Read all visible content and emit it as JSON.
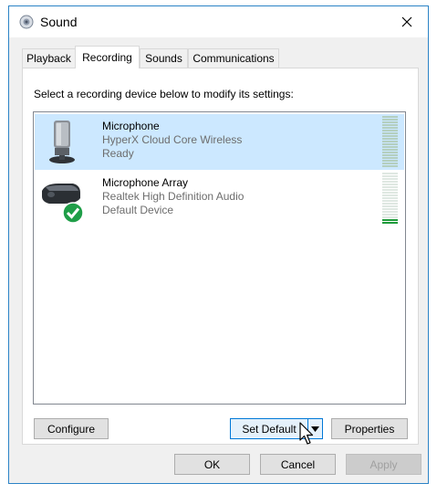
{
  "window": {
    "title": "Sound",
    "title_icon": "speaker-icon",
    "close_icon": "close-icon"
  },
  "tabs": [
    {
      "label": "Playback",
      "active": false
    },
    {
      "label": "Recording",
      "active": true
    },
    {
      "label": "Sounds",
      "active": false
    },
    {
      "label": "Communications",
      "active": false
    }
  ],
  "instruction": "Select a recording device below to modify its settings:",
  "devices": [
    {
      "name": "Microphone",
      "description": "HyperX Cloud Core Wireless",
      "status": "Ready",
      "icon": "headset-microphone-icon",
      "selected": true,
      "level": 0
    },
    {
      "name": "Microphone Array",
      "description": "Realtek High Definition Audio",
      "status": "Default Device",
      "icon": "webcam-microphone-icon",
      "selected": false,
      "default_badge": "green-check-icon",
      "level": 0.08
    }
  ],
  "buttons": {
    "configure": "Configure",
    "set_default": "Set Default",
    "properties": "Properties",
    "ok": "OK",
    "cancel": "Cancel",
    "apply": "Apply"
  },
  "colors": {
    "accent": "#0078d7",
    "selection": "#cce8ff",
    "level_active": "#1e9a3a"
  }
}
